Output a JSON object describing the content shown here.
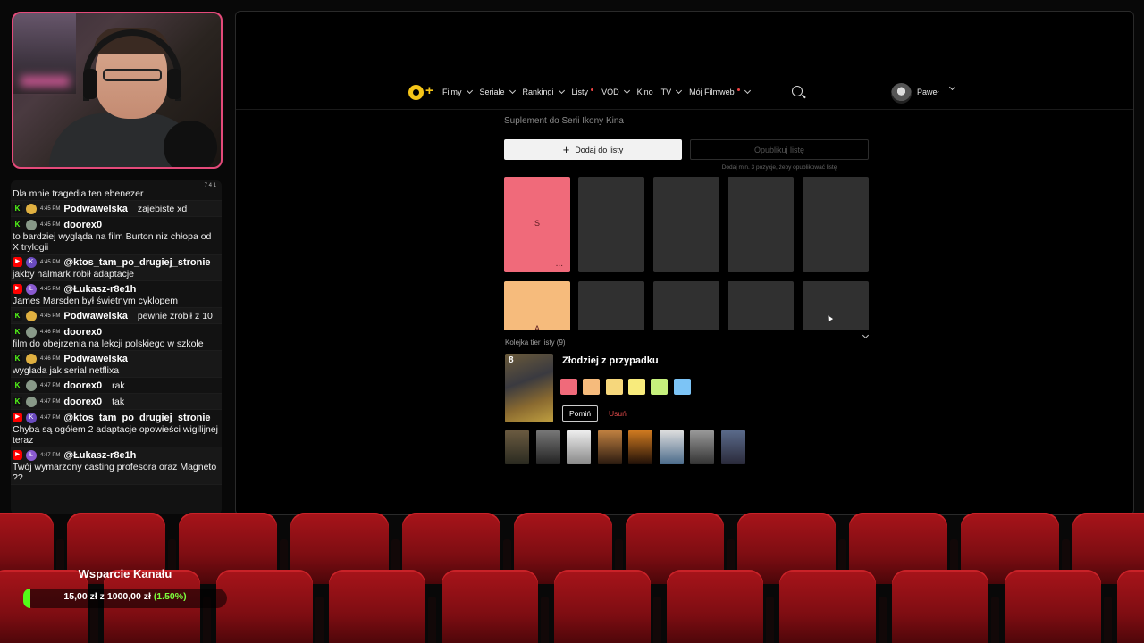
{
  "chat": {
    "top_icons": "7  4  1",
    "messages": [
      {
        "platform": "none",
        "time": "",
        "user": "",
        "text": "Dla mnie tragedia ten ebenezer",
        "inline": false,
        "avatar_color": "#555"
      },
      {
        "platform": "kick",
        "time": "4:45 PM",
        "user": "Podwawelska",
        "text": "zajebiste xd",
        "inline": true,
        "avatar_color": "#e0b040"
      },
      {
        "platform": "kick",
        "time": "4:45 PM",
        "user": "doorex0",
        "text": "to bardziej wygląda na film Burton niz chłopa od X trylogii",
        "inline": false,
        "avatar_color": "#889988"
      },
      {
        "platform": "yt",
        "time": "4:45 PM",
        "user": "@ktos_tam_po_drugiej_stronie",
        "text": "jakby halmark robił adaptacje",
        "inline": false,
        "avatar_color": "#6a4bbf",
        "avatar_letter": "K"
      },
      {
        "platform": "yt",
        "time": "4:45 PM",
        "user": "@Łukasz-r8e1h",
        "text": "James Marsden był świetnym cyklopem",
        "inline": false,
        "avatar_color": "#8a5ad0",
        "avatar_letter": "Ł"
      },
      {
        "platform": "kick",
        "time": "4:45 PM",
        "user": "Podwawelska",
        "text": "pewnie zrobił z 10",
        "inline": true,
        "avatar_color": "#e0b040"
      },
      {
        "platform": "kick",
        "time": "4:46 PM",
        "user": "doorex0",
        "text": "film do obejrzenia na lekcji polskiego w szkole",
        "inline": false,
        "avatar_color": "#889988"
      },
      {
        "platform": "kick",
        "time": "4:46 PM",
        "user": "Podwawelska",
        "text": "wyglada jak serial netflixa",
        "inline": false,
        "avatar_color": "#e0b040"
      },
      {
        "platform": "kick",
        "time": "4:47 PM",
        "user": "doorex0",
        "text": "rak",
        "inline": true,
        "avatar_color": "#889988"
      },
      {
        "platform": "kick",
        "time": "4:47 PM",
        "user": "doorex0",
        "text": "tak",
        "inline": true,
        "avatar_color": "#889988"
      },
      {
        "platform": "yt",
        "time": "4:47 PM",
        "user": "@ktos_tam_po_drugiej_stronie",
        "text": "Chyba są ogółem 2 adaptacje opowieści wigilijnej teraz",
        "inline": false,
        "avatar_color": "#6a4bbf",
        "avatar_letter": "K"
      },
      {
        "platform": "yt",
        "time": "4:47 PM",
        "user": "@Łukasz-r8e1h",
        "text": "Twój wymarzony casting profesora oraz Magneto ??",
        "inline": false,
        "avatar_color": "#8a5ad0",
        "avatar_letter": "Ł"
      }
    ]
  },
  "nav": {
    "logo_plus": "+",
    "links": [
      {
        "label": "Filmy",
        "chevron": true,
        "dot": false
      },
      {
        "label": "Seriale",
        "chevron": true,
        "dot": false
      },
      {
        "label": "Rankingi",
        "chevron": true,
        "dot": false
      },
      {
        "label": "Listy",
        "chevron": false,
        "dot": true
      },
      {
        "label": "VOD",
        "chevron": true,
        "dot": false
      },
      {
        "label": "Kino",
        "chevron": false,
        "dot": false
      },
      {
        "label": "TV",
        "chevron": true,
        "dot": false
      },
      {
        "label": "Mój Filmweb",
        "chevron": true,
        "dot": true
      }
    ],
    "user_name": "Paweł"
  },
  "page": {
    "subtitle": "Suplement do Serii Ikony Kina",
    "add_button": "Dodaj do listy",
    "add_icon": "+",
    "publish_button": "Opublikuj listę",
    "publish_hint": "Dodaj min. 3 pozycje, żeby opublikować listę"
  },
  "tiers": [
    {
      "label": "S",
      "color": "#f06a7a",
      "dots": "..."
    },
    {
      "label": "A",
      "color": "#f6bb7c",
      "dots": ""
    }
  ],
  "queue": {
    "title": "Kolejka tier listy (9)",
    "film_title": "Złodziej z przypadku",
    "rank_number": "8",
    "swatches": [
      "#f06a7a",
      "#f6bb7c",
      "#f6d77c",
      "#f8eb7c",
      "#c6f07c",
      "#7cc4f6"
    ],
    "skip_button": "Pomiń",
    "delete_button": "Usuń"
  },
  "support": {
    "title": "Wsparcie Kanału",
    "amount_text": "15,00 zł  z  1000,00 zł",
    "percent_text": "(1.50%)",
    "progress": 0.015
  }
}
